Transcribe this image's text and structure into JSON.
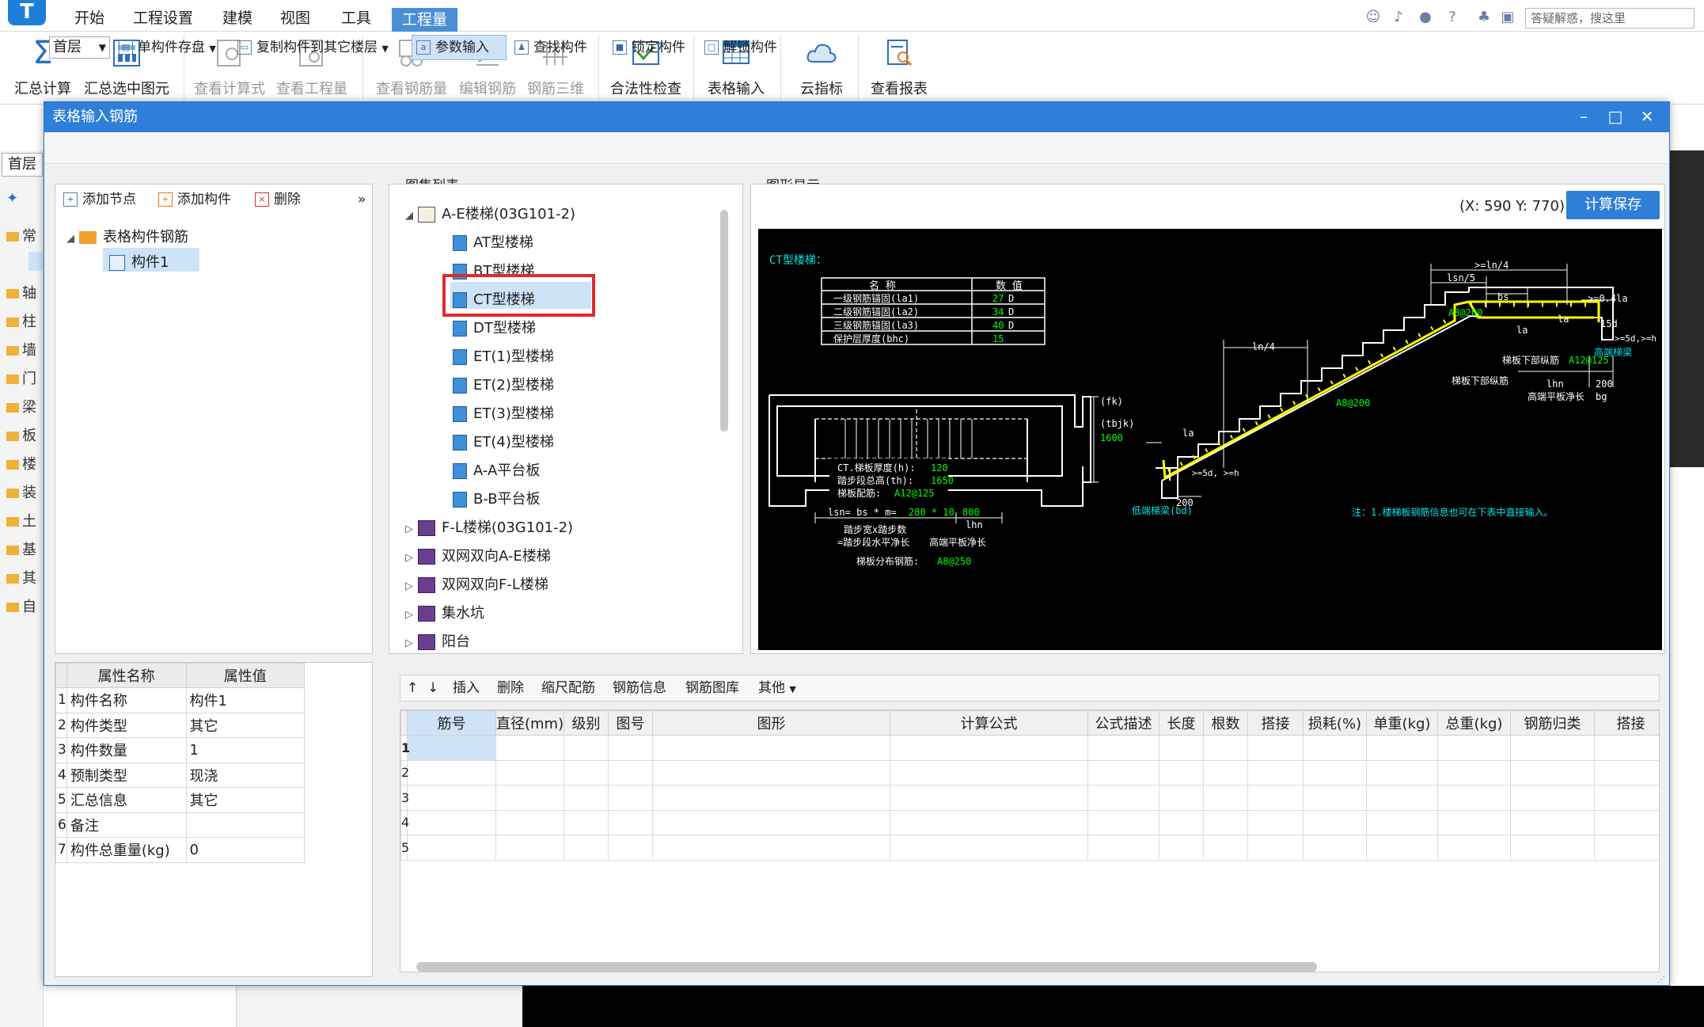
{
  "menubar": {
    "logo": "T",
    "items": [
      "开始",
      "工程设置",
      "建模",
      "视图",
      "工具"
    ],
    "active": "工程量",
    "search_placeholder": "答疑解惑，搜这里",
    "help": "?"
  },
  "ribbon": {
    "buttons": [
      {
        "label": "汇总计算",
        "icon": "sigma-icon",
        "enabled": true
      },
      {
        "label": "汇总选中图元",
        "icon": "calc-icon",
        "enabled": true
      },
      {
        "label": "查看计算式",
        "icon": "formula-icon",
        "enabled": false
      },
      {
        "label": "查看工程量",
        "icon": "quantity-icon",
        "enabled": false
      },
      {
        "label": "查看钢筋量",
        "icon": "rebar-icon",
        "enabled": false
      },
      {
        "label": "编辑钢筋",
        "icon": "edit-icon",
        "enabled": false
      },
      {
        "label": "钢筋三维",
        "icon": "3d-icon",
        "enabled": false
      },
      {
        "label": "合法性检查",
        "icon": "check-icon",
        "enabled": true
      },
      {
        "label": "表格输入",
        "icon": "table-icon",
        "enabled": true
      },
      {
        "label": "云指标",
        "icon": "cloud-icon",
        "enabled": true
      },
      {
        "label": "查看报表",
        "icon": "report-icon",
        "enabled": true
      }
    ]
  },
  "background": {
    "floor_tab": "首层",
    "left_items": [
      "常",
      "轴",
      "柱",
      "墙",
      "门",
      "梁",
      "板",
      "楼",
      "装",
      "土",
      "基",
      "其",
      "自"
    ]
  },
  "dialog": {
    "title": "表格输入钢筋",
    "toolbar": {
      "floor": "首层",
      "save_single": "单构件存盘",
      "copy_floor": "复制构件到其它楼层",
      "param_input": "参数输入",
      "find": "查找构件",
      "lock": "锁定构件",
      "unlock": "解锁构件"
    },
    "tree_toolbar": {
      "add_node": "添加节点",
      "add_component": "添加构件",
      "delete": "删除",
      "more": "»"
    },
    "tree": {
      "root": "表格构件钢筋",
      "child": "构件1"
    },
    "props": {
      "headers": [
        "属性名称",
        "属性值"
      ],
      "rows": [
        {
          "n": "1",
          "name": "构件名称",
          "value": "构件1"
        },
        {
          "n": "2",
          "name": "构件类型",
          "value": "其它"
        },
        {
          "n": "3",
          "name": "构件数量",
          "value": "1"
        },
        {
          "n": "4",
          "name": "预制类型",
          "value": "现浇"
        },
        {
          "n": "5",
          "name": "汇总信息",
          "value": "其它"
        },
        {
          "n": "6",
          "name": "备注",
          "value": ""
        },
        {
          "n": "7",
          "name": "构件总重量(kg)",
          "value": "0"
        }
      ]
    },
    "atlas": {
      "title": "图集列表",
      "group1": "A-E楼梯(03G101-2)",
      "items": [
        "AT型楼梯",
        "BT型楼梯",
        "CT型楼梯",
        "DT型楼梯",
        "ET(1)型楼梯",
        "ET(2)型楼梯",
        "ET(3)型楼梯",
        "ET(4)型楼梯",
        "A-A平台板",
        "B-B平台板"
      ],
      "selected": "CT型楼梯",
      "groups": [
        "F-L楼梯(03G101-2)",
        "双网双向A-E楼梯",
        "双网双向F-L楼梯",
        "集水坑",
        "阳台"
      ]
    },
    "graph": {
      "title": "图形显示",
      "coords": "(X: 590 Y: 770)",
      "save_button": "计算保存",
      "drawing": {
        "caption": "CT型楼梯：",
        "table_headers": [
          "名 称",
          "数 值"
        ],
        "table_rows": [
          {
            "name": "一级钢筋锚固(la1)",
            "value": "27",
            "unit": "D"
          },
          {
            "name": "二级钢筋锚固(la2)",
            "value": "34",
            "unit": "D"
          },
          {
            "name": "三级钢筋锚固(la3)",
            "value": "40",
            "unit": "D"
          },
          {
            "name": "保护层厚度(bhc)",
            "value": "15",
            "unit": ""
          }
        ],
        "plan_text1": "CT.梯板厚度(h):",
        "plan_val1": "120",
        "plan_text2": "踏步段总高(th):",
        "plan_val2": "1650",
        "plan_text3": "梯板配筋:",
        "plan_val3": "A12@125",
        "fk": "(fk)",
        "tbjk": "(tbjk)",
        "tbjk_val": "1600",
        "lsn_text": "lsn= bs * m=",
        "lsn_val": "280 * 10",
        "lhn_val": "800",
        "lhn": "lhn",
        "step_line1": "踏步宽x踏步数",
        "step_line2": "=踏步段水平净长",
        "step_line3": "高端平板净长",
        "dist_text": "梯板分布钢筋:",
        "dist_val": "A8@250",
        "ln4a": ">=ln/4",
        "lsn5": "lsn/5",
        "bs": "bs",
        "ge04la": ">=0.4la",
        "a8200a": "A8@200",
        "a8200b": "A8@200",
        "ln4b": "ln/4",
        "la": "la",
        "la2": "la",
        "la3": "la",
        "d15": "15d",
        "ge5dh": ">=5d,>=h",
        "ge5dh2": ">=5d, >=h",
        "lower_rebar": "梯板下部纵筋",
        "lower_val": "A12@125",
        "high_beam": "高端梯梁",
        "lower_rebar2": "梯板下部纵筋",
        "lhn2": "lhn",
        "v200": "200",
        "high_plate": "高端平板净长",
        "bg": "bg",
        "v200b": "200",
        "low_beam": "低端梯梁(bd)",
        "note": "注：1.楼梯板钢筋信息也可在下表中直接输入。"
      }
    },
    "grid": {
      "toolbar": {
        "up": "↑",
        "down": "↓",
        "insert": "插入",
        "delete": "删除",
        "scale": "缩尺配筋",
        "info": "钢筋信息",
        "library": "钢筋图库",
        "other": "其他"
      },
      "columns": [
        "筋号",
        "直径(mm)",
        "级别",
        "图号",
        "图形",
        "计算公式",
        "公式描述",
        "长度",
        "根数",
        "搭接",
        "损耗(%)",
        "单重(kg)",
        "总重(kg)",
        "钢筋归类",
        "搭接"
      ],
      "row_numbers": [
        "1",
        "2",
        "3",
        "4",
        "5"
      ]
    }
  }
}
